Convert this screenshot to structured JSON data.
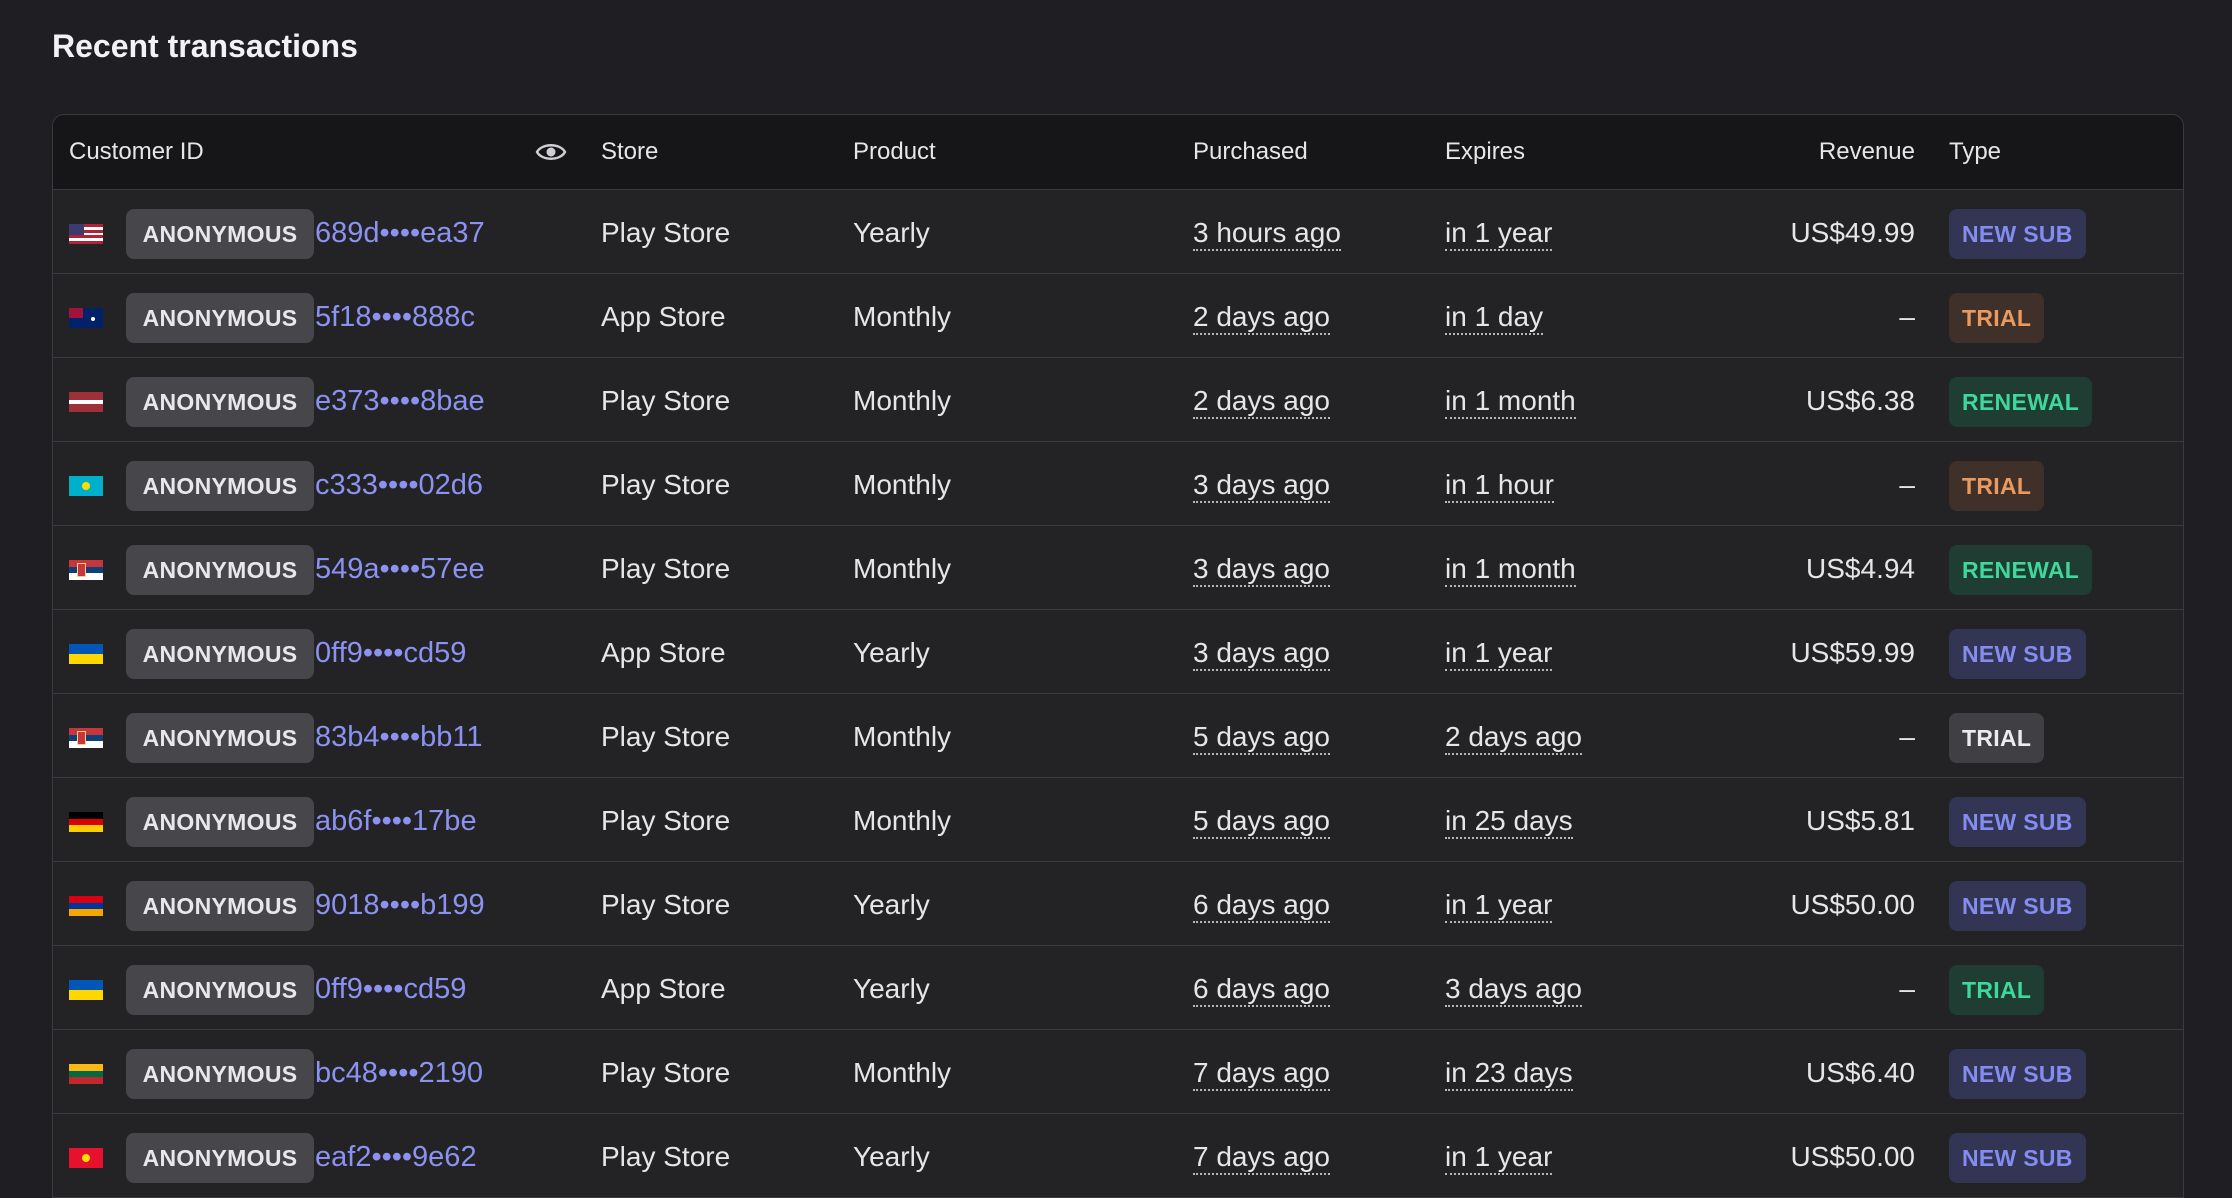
{
  "page": {
    "title": "Recent transactions"
  },
  "table": {
    "columns": {
      "customer_id": "Customer ID",
      "store": "Store",
      "product": "Product",
      "purchased": "Purchased",
      "expires": "Expires",
      "revenue": "Revenue",
      "type": "Type"
    },
    "reveal_icon": "eye-icon",
    "rows": [
      {
        "flag": "us",
        "tag": "ANONYMOUS",
        "customer_id": "689d••••ea37",
        "store": "Play Store",
        "product": "Yearly",
        "purchased": "3 hours ago",
        "expires": "in 1 year",
        "revenue": "US$49.99",
        "type": "NEW SUB",
        "type_style": "new"
      },
      {
        "flag": "au",
        "tag": "ANONYMOUS",
        "customer_id": "5f18••••888c",
        "store": "App Store",
        "product": "Monthly",
        "purchased": "2 days ago",
        "expires": "in 1 day",
        "revenue": "–",
        "type": "TRIAL",
        "type_style": "trial-orange"
      },
      {
        "flag": "lv",
        "tag": "ANONYMOUS",
        "customer_id": "e373••••8bae",
        "store": "Play Store",
        "product": "Monthly",
        "purchased": "2 days ago",
        "expires": "in 1 month",
        "revenue": "US$6.38",
        "type": "RENEWAL",
        "type_style": "renewal"
      },
      {
        "flag": "kz",
        "tag": "ANONYMOUS",
        "customer_id": "c333••••02d6",
        "store": "Play Store",
        "product": "Monthly",
        "purchased": "3 days ago",
        "expires": "in 1 hour",
        "revenue": "–",
        "type": "TRIAL",
        "type_style": "trial-orange"
      },
      {
        "flag": "rs",
        "tag": "ANONYMOUS",
        "customer_id": "549a••••57ee",
        "store": "Play Store",
        "product": "Monthly",
        "purchased": "3 days ago",
        "expires": "in 1 month",
        "revenue": "US$4.94",
        "type": "RENEWAL",
        "type_style": "renewal"
      },
      {
        "flag": "ua",
        "tag": "ANONYMOUS",
        "customer_id": "0ff9••••cd59",
        "store": "App Store",
        "product": "Yearly",
        "purchased": "3 days ago",
        "expires": "in 1 year",
        "revenue": "US$59.99",
        "type": "NEW SUB",
        "type_style": "new"
      },
      {
        "flag": "rs",
        "tag": "ANONYMOUS",
        "customer_id": "83b4••••bb11",
        "store": "Play Store",
        "product": "Monthly",
        "purchased": "5 days ago",
        "expires": "2 days ago",
        "revenue": "–",
        "type": "TRIAL",
        "type_style": "trial-gray"
      },
      {
        "flag": "de",
        "tag": "ANONYMOUS",
        "customer_id": "ab6f••••17be",
        "store": "Play Store",
        "product": "Monthly",
        "purchased": "5 days ago",
        "expires": "in 25 days",
        "revenue": "US$5.81",
        "type": "NEW SUB",
        "type_style": "new"
      },
      {
        "flag": "am",
        "tag": "ANONYMOUS",
        "customer_id": "9018••••b199",
        "store": "Play Store",
        "product": "Yearly",
        "purchased": "6 days ago",
        "expires": "in 1 year",
        "revenue": "US$50.00",
        "type": "NEW SUB",
        "type_style": "new"
      },
      {
        "flag": "ua",
        "tag": "ANONYMOUS",
        "customer_id": "0ff9••••cd59",
        "store": "App Store",
        "product": "Yearly",
        "purchased": "6 days ago",
        "expires": "3 days ago",
        "revenue": "–",
        "type": "TRIAL",
        "type_style": "trial-green"
      },
      {
        "flag": "lt",
        "tag": "ANONYMOUS",
        "customer_id": "bc48••••2190",
        "store": "Play Store",
        "product": "Monthly",
        "purchased": "7 days ago",
        "expires": "in 23 days",
        "revenue": "US$6.40",
        "type": "NEW SUB",
        "type_style": "new"
      },
      {
        "flag": "kg",
        "tag": "ANONYMOUS",
        "customer_id": "eaf2••••9e62",
        "store": "Play Store",
        "product": "Yearly",
        "purchased": "7 days ago",
        "expires": "in 1 year",
        "revenue": "US$50.00",
        "type": "NEW SUB",
        "type_style": "new"
      }
    ]
  },
  "colors": {
    "background": "#1f1f23",
    "customer_id_link": "#8b92f0",
    "badge_new_sub": "#858cf0",
    "badge_trial": "#ea9a5f",
    "badge_renewal": "#3ed79c"
  }
}
